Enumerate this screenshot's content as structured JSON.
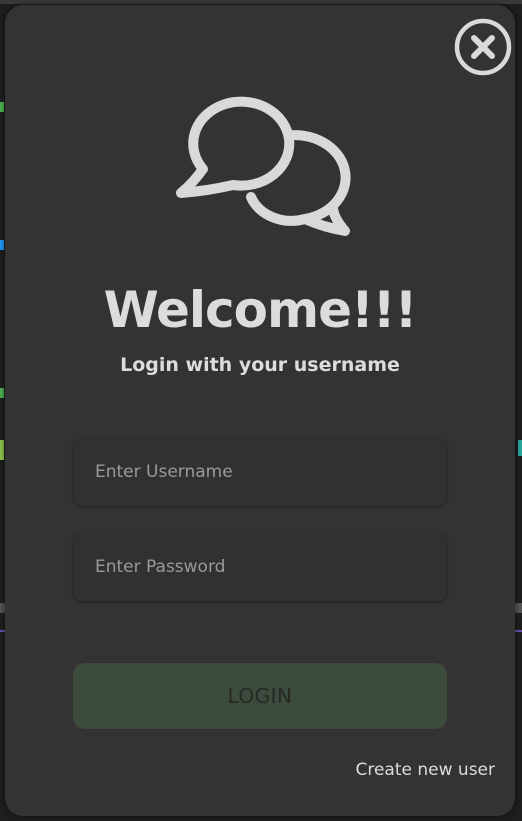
{
  "modal": {
    "title": "Welcome!!!",
    "subtitle": "Login with your username",
    "icons": {
      "close": "close-icon",
      "chat": "chat-bubbles-icon"
    },
    "username": {
      "placeholder": "Enter Username",
      "value": ""
    },
    "password": {
      "placeholder": "Enter Password",
      "value": ""
    },
    "login_label": "LOGIN",
    "create_user_label": "Create new user"
  },
  "colors": {
    "modal_background": "#333333",
    "text": "#dcdcdc",
    "login_button": "#3b4b3c",
    "icon": "#d9d9d9"
  }
}
